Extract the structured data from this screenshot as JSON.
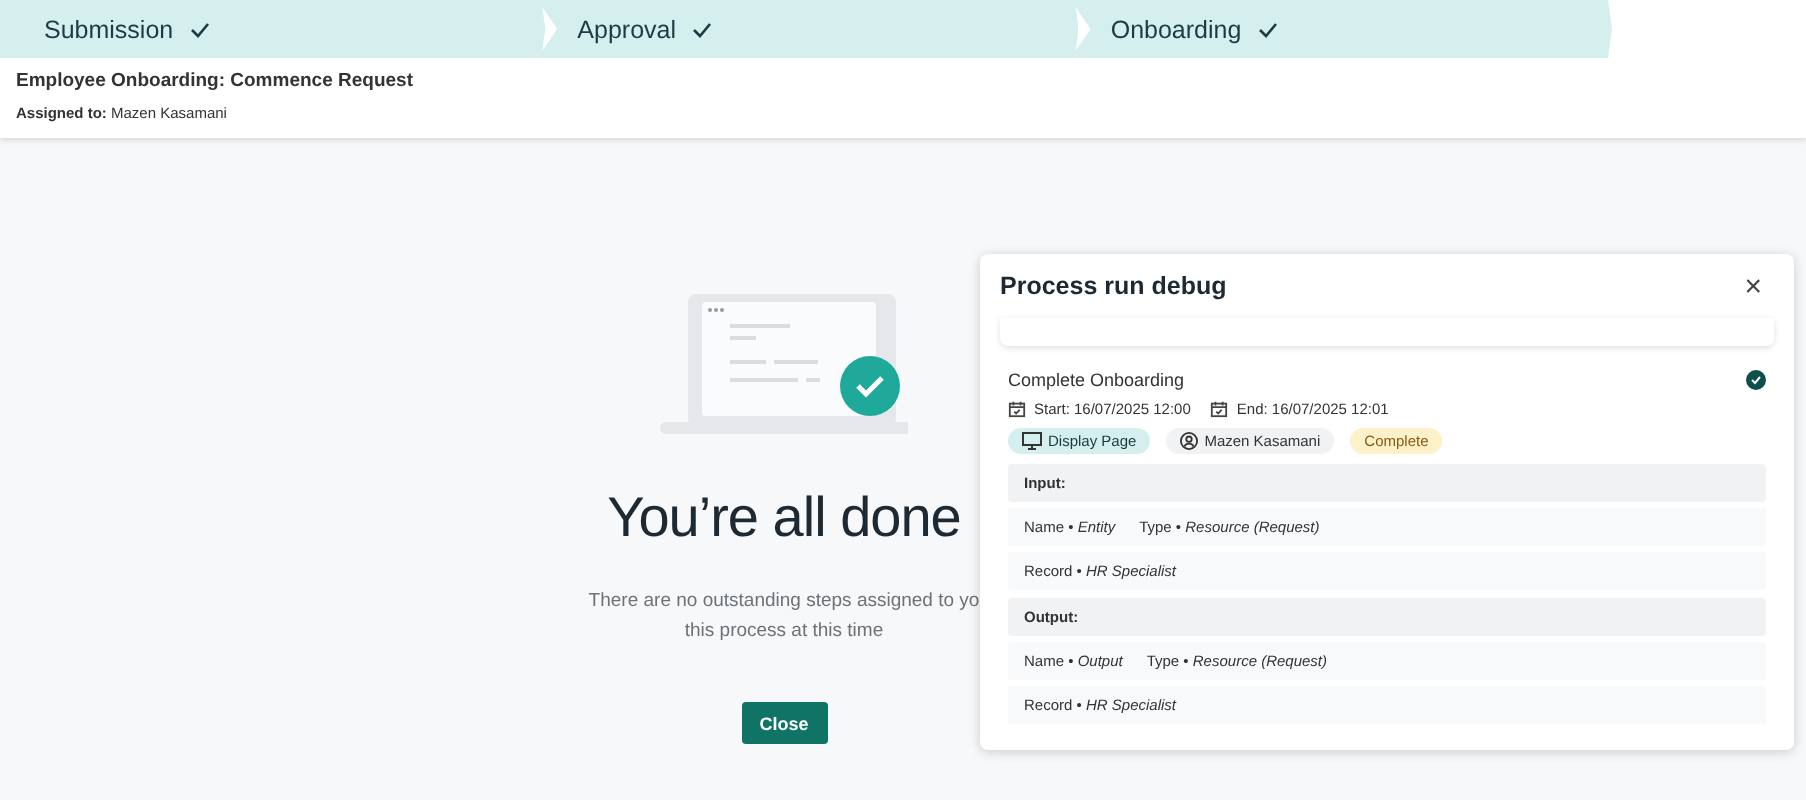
{
  "steps": [
    {
      "label": "Submission",
      "completed": true
    },
    {
      "label": "Approval",
      "completed": true
    },
    {
      "label": "Onboarding",
      "completed": true
    }
  ],
  "task": {
    "title": "Employee Onboarding: Commence Request",
    "assigned_label": "Assigned to:",
    "assigned_name": "Mazen Kasamani"
  },
  "completion": {
    "heading": "You’re all done",
    "message_lines": [
      "There are no outstanding steps assigned to yo",
      "this process at this time"
    ],
    "button": "Close"
  },
  "debug_panel": {
    "title": "Process run debug",
    "close": "×",
    "step": {
      "name": "Complete Onboarding",
      "done": true,
      "start": "Start: 16/07/2025 12:00",
      "end": "End: 16/07/2025 12:01",
      "type_tag": "Display Page",
      "user_tag": "Mazen Kasamani",
      "status": "Complete",
      "sections": [
        {
          "heading": "Input:",
          "rows": [
            [
              "Name • *Entity*",
              "Type • *Resource (Request)*"
            ],
            [
              "Record • *HR Specialist*"
            ]
          ]
        },
        {
          "heading": "Output:",
          "rows": [
            [
              "Name • *Output*",
              "Type • *Resource (Request)*"
            ],
            [
              "Record • *HR Specialist*"
            ]
          ]
        }
      ]
    }
  }
}
